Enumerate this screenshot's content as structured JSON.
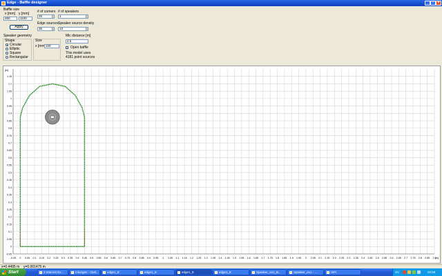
{
  "window": {
    "title": "Edge - Baffle designer",
    "controls": [
      "_",
      "□",
      "×"
    ]
  },
  "baffle_size": {
    "label": "Baffle size",
    "x_label": "x [mm]",
    "y_label": "y [mm]",
    "x_value": "450",
    "y_value": "1100",
    "apply_label": "Apply"
  },
  "corners": {
    "label": "# of corners",
    "value": "25"
  },
  "speakers": {
    "label": "# of speakers",
    "value": "1"
  },
  "edge_sources": {
    "label": "Edge sources",
    "value": "36"
  },
  "source_density": {
    "label": "Speaker source density",
    "value": "13"
  },
  "mic_distance": {
    "label": "Mic distance [m]",
    "value": "2.5"
  },
  "open_baffle": {
    "label": "Open baffle",
    "checked": true
  },
  "model_info": {
    "line1": "This model uses",
    "line2": "4181 point sources"
  },
  "geometry": {
    "label": "Speaker geometry",
    "shape_label": "Shape",
    "shapes": [
      {
        "label": "Circular",
        "selected": true
      },
      {
        "label": "Elliptic",
        "selected": false
      },
      {
        "label": "Square",
        "selected": false
      },
      {
        "label": "Rectangular",
        "selected": false
      }
    ],
    "size_label": "Size",
    "size_field_label": "x [mm]",
    "size_value": "100"
  },
  "chart_data": {
    "type": "line",
    "x_unit_label": "[m]",
    "y_unit_label": "[m]",
    "xlim": [
      -0.05,
      2.9
    ],
    "ylim": [
      -0.05,
      1.2
    ],
    "grid": true,
    "x_ticks": [
      "-0.05",
      "0",
      "0.05",
      "0.1",
      "0.15",
      "0.2",
      "0.25",
      "0.3",
      "0.35",
      "0.4",
      "0.45",
      "0.5",
      "0.55",
      "0.6",
      "0.65",
      "0.7",
      "0.75",
      "0.8",
      "0.85",
      "0.9",
      "0.95",
      "1",
      "1.05",
      "1.1",
      "1.15",
      "1.2",
      "1.25",
      "1.3",
      "1.35",
      "1.4",
      "1.45",
      "1.5",
      "1.55",
      "1.6",
      "1.65",
      "1.7",
      "1.75",
      "1.8",
      "1.85",
      "1.9",
      "1.95",
      "2",
      "2.05",
      "2.1",
      "2.15",
      "2.2",
      "2.25",
      "2.3",
      "2.35",
      "2.4",
      "2.45",
      "2.5",
      "2.55",
      "2.6",
      "2.65",
      "2.7",
      "2.75",
      "2.8",
      "2.85",
      "2.9"
    ],
    "y_ticks": [
      "-0.05",
      "0",
      "0.05",
      "0.1",
      "0.15",
      "0.2",
      "0.25",
      "0.3",
      "0.35",
      "0.4",
      "0.45",
      "0.5",
      "0.55",
      "0.6",
      "0.65",
      "0.7",
      "0.75",
      "0.8",
      "0.85",
      "0.9",
      "0.95",
      "1",
      "1.05",
      "1.1",
      "1.15"
    ],
    "baffle_outline": {
      "x": [
        0,
        0.45,
        0.45,
        0.4335,
        0.3856,
        0.3138,
        0.225,
        0.1362,
        0.0644,
        0.0165,
        0,
        0
      ],
      "y": [
        0,
        0,
        0.875,
        0.9375,
        1.0212,
        1.0825,
        1.1,
        1.0825,
        1.0212,
        0.9375,
        0.875,
        0
      ]
    },
    "speaker": {
      "center_x": 0.225,
      "center_y": 0.875,
      "diameter": 0.1
    }
  },
  "statusbar": {
    "x_readout": "x=0.4495 m",
    "y_readout": "y=0.001475 m"
  },
  "taskbar": {
    "start_label": "Start",
    "tasks": [
      "3 Internet Ex...",
      "Inkorgen - Outl...",
      "edge1_8",
      "edge1_8",
      "edge1_8",
      "edge1_8",
      "Speaker_ex1_B...",
      "Speaker_ex1 - ...",
      "HiFi"
    ],
    "active_task": 4,
    "lang": "SV",
    "clock": "20:58"
  }
}
